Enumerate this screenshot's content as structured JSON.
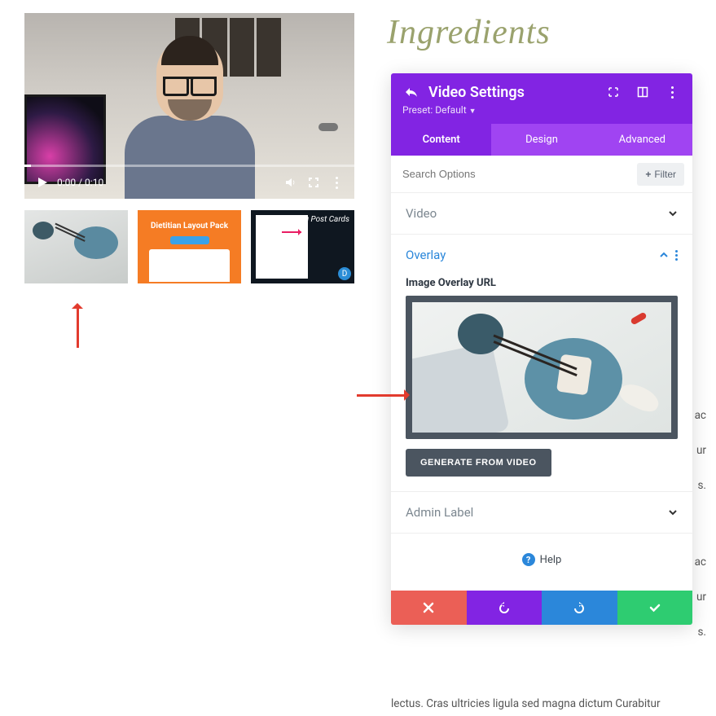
{
  "video": {
    "time_current": "0:00",
    "time_total": "0:10"
  },
  "thumbnails": {
    "thumb2_title": "Dietitian Layout Pack",
    "thumb3_title": "Floating Blog Post Cards",
    "thumb3_mark": "D"
  },
  "page": {
    "ingredients_heading": "Ingredients",
    "lorem_frag_a": "s ac",
    "lorem_frag_b": "ur",
    "lorem_frag_c": "s.",
    "lorem_line": "lectus. Cras ultricies ligula sed magna dictum Curabitur"
  },
  "panel": {
    "title": "Video Settings",
    "preset": "Preset: Default",
    "tabs": {
      "content": "Content",
      "design": "Design",
      "advanced": "Advanced"
    },
    "search_placeholder": "Search Options",
    "filter_label": "Filter",
    "sections": {
      "video": "Video",
      "overlay": "Overlay",
      "admin_label": "Admin Label"
    },
    "overlay_field_label": "Image Overlay URL",
    "generate_btn": "GENERATE FROM VIDEO",
    "help": "Help"
  }
}
